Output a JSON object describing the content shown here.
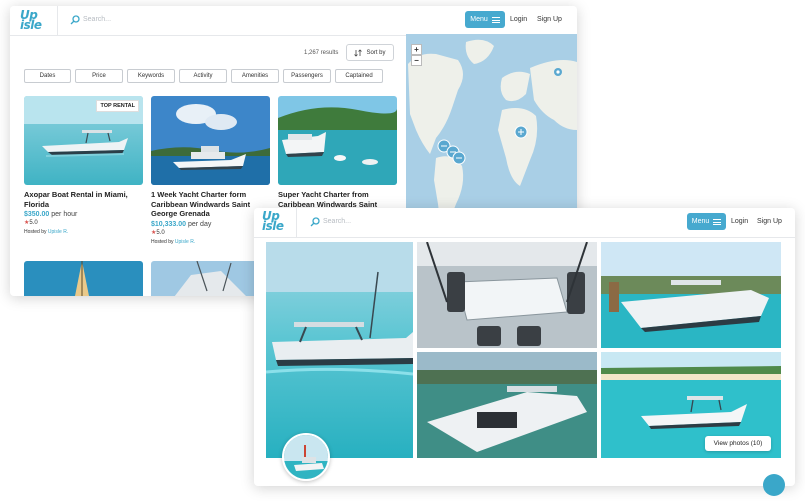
{
  "brand": {
    "logo_line1": "Up",
    "logo_line2": "isle",
    "color": "#3aa7c9"
  },
  "header": {
    "search_placeholder": "Search...",
    "menu_label": "Menu",
    "login_label": "Login",
    "signup_label": "Sign Up"
  },
  "results": {
    "count_text": "1,267 results",
    "sort_label": "Sort by"
  },
  "filters": [
    "Dates",
    "Price",
    "Keywords",
    "Activity",
    "Amenities",
    "Passengers",
    "Captained"
  ],
  "listings": [
    {
      "badge": "TOP RENTAL",
      "title": "Axopar Boat Rental in Miami, Florida",
      "price": "$350.00",
      "unit": "per hour",
      "rating": "5.0",
      "host_prefix": "Hosted by",
      "host": "Upisle R."
    },
    {
      "badge": "",
      "title": "1 Week Yacht Charter form Caribbean Windwards Saint George Grenada",
      "price": "$10,333.00",
      "unit": "per day",
      "rating": "5.0",
      "host_prefix": "Hosted by",
      "host": "Upisle R."
    },
    {
      "badge": "",
      "title": "Super Yacht Charter from Caribbean Windwards Saint",
      "price": "",
      "unit": "",
      "rating": "",
      "host_prefix": "",
      "host": ""
    }
  ],
  "map": {
    "zoom_in": "+",
    "zoom_out": "−"
  },
  "gallery": {
    "view_photos_label": "View photos (10)"
  },
  "icons": [
    "search-icon",
    "hamburger-icon",
    "sort-icon",
    "map-pin-icon",
    "star-icon",
    "chat-icon"
  ],
  "colors": {
    "accent": "#46a9cf",
    "price": "#3aa7c9",
    "star": "#d9534f",
    "ocean": "#a9cfe6",
    "land": "#eef0ea"
  }
}
